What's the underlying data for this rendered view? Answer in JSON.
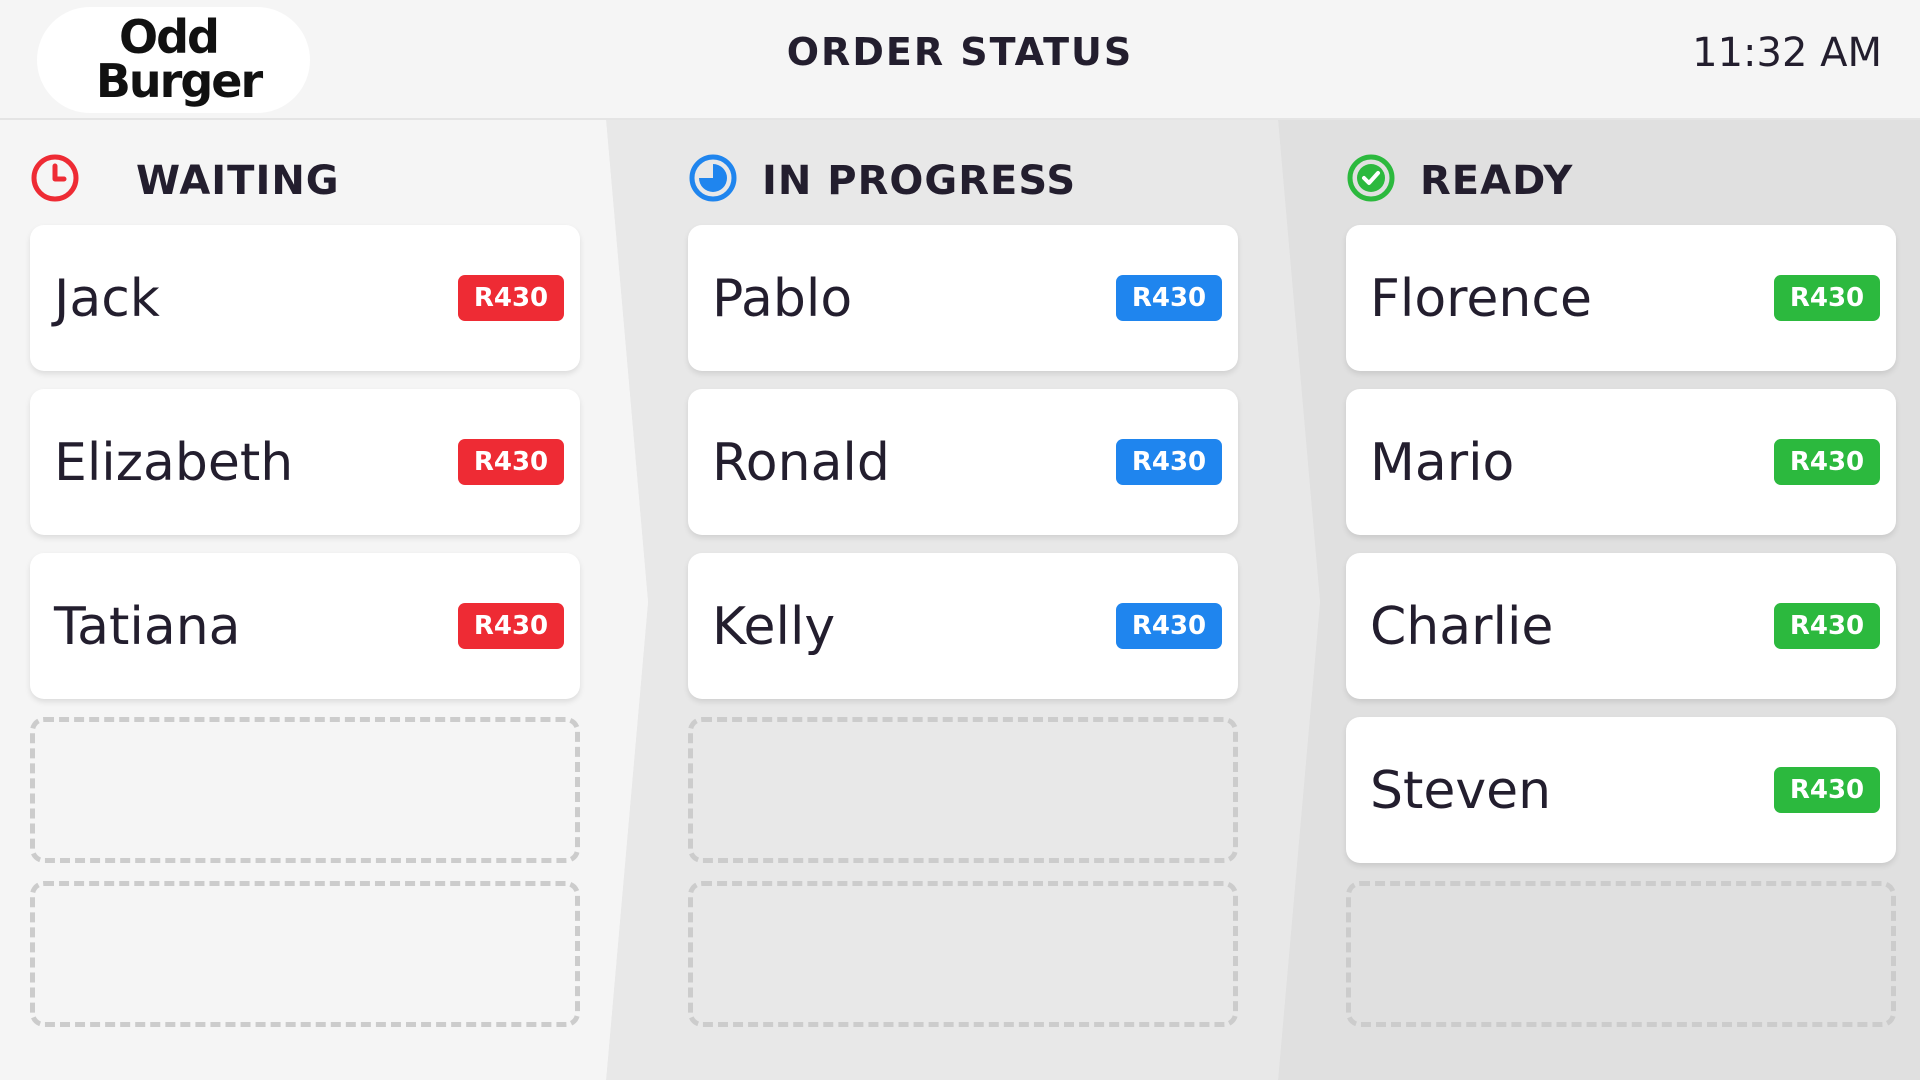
{
  "header": {
    "logo_line1": "Odd",
    "logo_line2": "Burger",
    "title": "ORDER STATUS",
    "time": "11:32 AM"
  },
  "colors": {
    "waiting": "#ee2b34",
    "in_progress": "#1f85ee",
    "ready": "#2cb93e",
    "text": "#231e2e"
  },
  "columns": {
    "waiting": {
      "title": "WAITING",
      "icon": "clock-icon",
      "orders": [
        {
          "name": "Jack",
          "price": "R430"
        },
        {
          "name": "Elizabeth",
          "price": "R430"
        },
        {
          "name": "Tatiana",
          "price": "R430"
        }
      ],
      "empty_slots": 2
    },
    "in_progress": {
      "title": "IN PROGRESS",
      "icon": "progress-pie-icon",
      "orders": [
        {
          "name": "Pablo",
          "price": "R430"
        },
        {
          "name": "Ronald",
          "price": "R430"
        },
        {
          "name": "Kelly",
          "price": "R430"
        }
      ],
      "empty_slots": 2
    },
    "ready": {
      "title": "READY",
      "icon": "checkmark-circle-icon",
      "orders": [
        {
          "name": "Florence",
          "price": "R430"
        },
        {
          "name": "Mario",
          "price": "R430"
        },
        {
          "name": "Charlie",
          "price": "R430"
        },
        {
          "name": "Steven",
          "price": "R430"
        }
      ],
      "empty_slots": 1
    }
  }
}
